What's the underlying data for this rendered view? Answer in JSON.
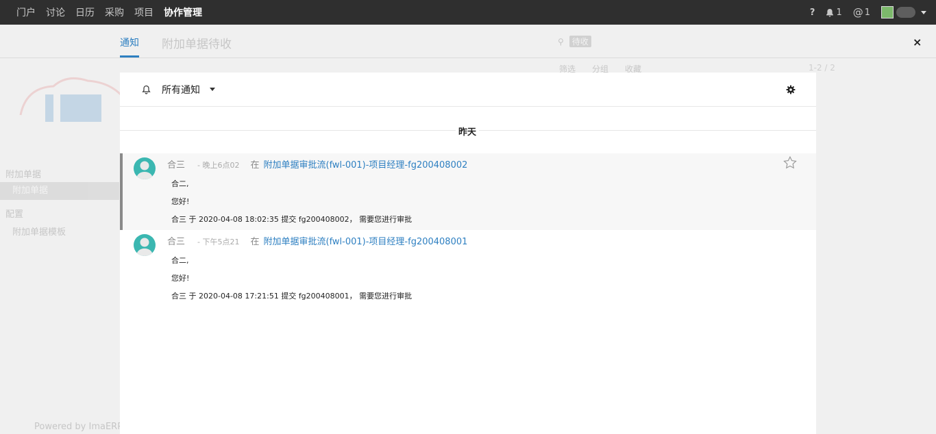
{
  "topbar": {
    "nav": [
      "门户",
      "讨论",
      "日历",
      "采购",
      "项目",
      "协作管理"
    ],
    "help": "?",
    "bell_count": "1",
    "at_count": "1"
  },
  "background": {
    "title": "附加单据待收",
    "sidebar": [
      "附加单据",
      "附加单据",
      "配置",
      "附加单据模板"
    ],
    "search_chip": "待收",
    "tools": [
      "筛选",
      "分组",
      "收藏"
    ],
    "pager": "1-2 / 2",
    "footer": "Powered by ImaERP"
  },
  "overlay": {
    "tab": "通知",
    "close": "×",
    "filter_label": "所有通知",
    "day_label": "昨天",
    "items": [
      {
        "author": "合三",
        "time": "- 晚上6点02",
        "in_label": "在",
        "link": "附加单据审批流(fwl-001)-项目经理-fg200408002",
        "line1": "合二,",
        "line2": "您好!",
        "line3": "合三 于 2020-04-08 18:02:35 提交 fg200408002， 需要您进行审批",
        "unread": true
      },
      {
        "author": "合三",
        "time": "- 下午5点21",
        "in_label": "在",
        "link": "附加单据审批流(fwl-001)-项目经理-fg200408001",
        "line1": "合二,",
        "line2": "您好!",
        "line3": "合三 于 2020-04-08 17:21:51 提交 fg200408001， 需要您进行审批",
        "unread": false
      }
    ]
  }
}
